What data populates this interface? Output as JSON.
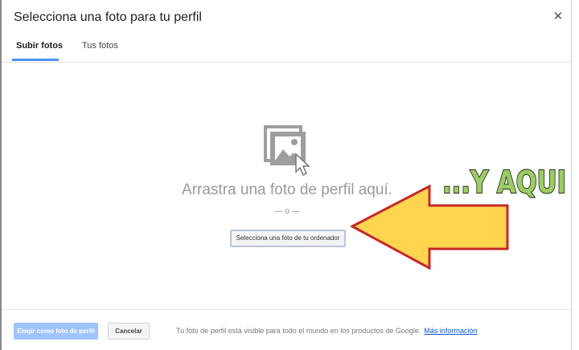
{
  "dialog": {
    "title": "Selecciona una foto para tu perfil",
    "close_icon": "close-icon"
  },
  "tabs": [
    {
      "label": "Subir fotos",
      "active": true
    },
    {
      "label": "Tus fotos",
      "active": false
    }
  ],
  "upload": {
    "icon": "photo-upload-icon",
    "drop_text": "Arrastra una foto de perfil aquí.",
    "separator": "— o —",
    "select_button": "Selecciona una foto de tu ordenador"
  },
  "footer": {
    "primary_button": "Elegir como foto de perfil",
    "primary_enabled": false,
    "cancel_button": "Cancelar",
    "note": "Tu foto de perfil está visible para todo el mundo en los productos de Google.",
    "link": "Más información"
  },
  "annotation": {
    "text": "...Y AQUI",
    "arrow_color": "#ffd54f",
    "arrow_outline": "#c62828",
    "text_color": "#9ccc65",
    "text_outline": "#2e3b1e"
  },
  "colors": {
    "tab_accent": "#4d90fe",
    "primary_disabled": "#a0c3ff",
    "link": "#1155cc"
  }
}
